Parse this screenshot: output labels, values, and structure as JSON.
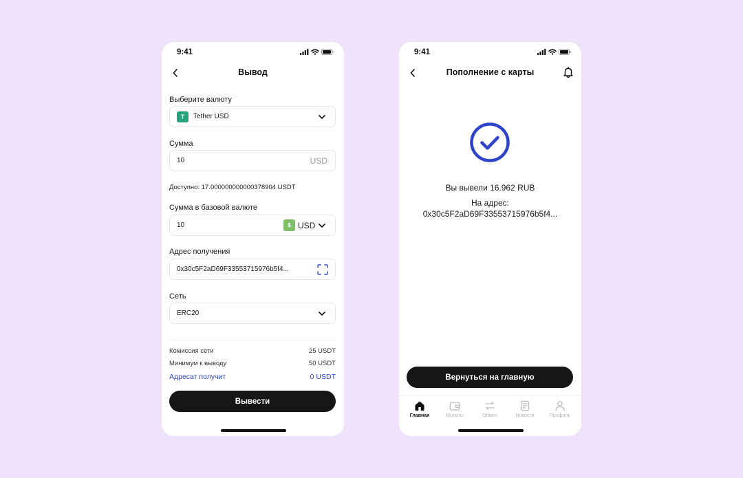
{
  "colors": {
    "background": "#efe3fb",
    "accent": "#2f45c9",
    "tether": "#26a17b",
    "usd": "#7fbf6a",
    "button": "#161616"
  },
  "left": {
    "status_time": "9:41",
    "title": "Вывод",
    "currency_label": "Выберите валюту",
    "currency": {
      "icon_letter": "T",
      "value": "Tether USD"
    },
    "amount_label": "Сумма",
    "amount": {
      "value": "10",
      "suffix": "USD"
    },
    "available": "Доступно: 17.000000000000378904 USDT",
    "base_label": "Сумма в базовой валюте",
    "base": {
      "value": "10",
      "badge": "$",
      "currency": "USD"
    },
    "address_label": "Адрес получения",
    "address": "0x30c5F2aD69F33553715976b5f4...",
    "network_label": "Сеть",
    "network": "ERC20",
    "fees": [
      {
        "label": "Комиссия сети",
        "value": "25 USDT"
      },
      {
        "label": "Минимум к выводу",
        "value": "50 USDT"
      },
      {
        "label": "Адресат получит",
        "value": "0 USDT"
      }
    ],
    "submit": "Вывести"
  },
  "right": {
    "status_time": "9:41",
    "title": "Пополнение с карты",
    "result_amount": "Вы вывели 16.962 RUB",
    "result_address_label": "На адрес:",
    "result_address": "0x30c5F2aD69F33553715976b5f4...",
    "home_button": "Вернуться на главную",
    "tabs": [
      {
        "label": "Главная",
        "icon": "home-icon",
        "active": true
      },
      {
        "label": "Валюты",
        "icon": "wallet-icon",
        "active": false
      },
      {
        "label": "Обмен",
        "icon": "exchange-icon",
        "active": false
      },
      {
        "label": "Новости",
        "icon": "news-icon",
        "active": false
      },
      {
        "label": "Профиль",
        "icon": "profile-icon",
        "active": false
      }
    ]
  }
}
